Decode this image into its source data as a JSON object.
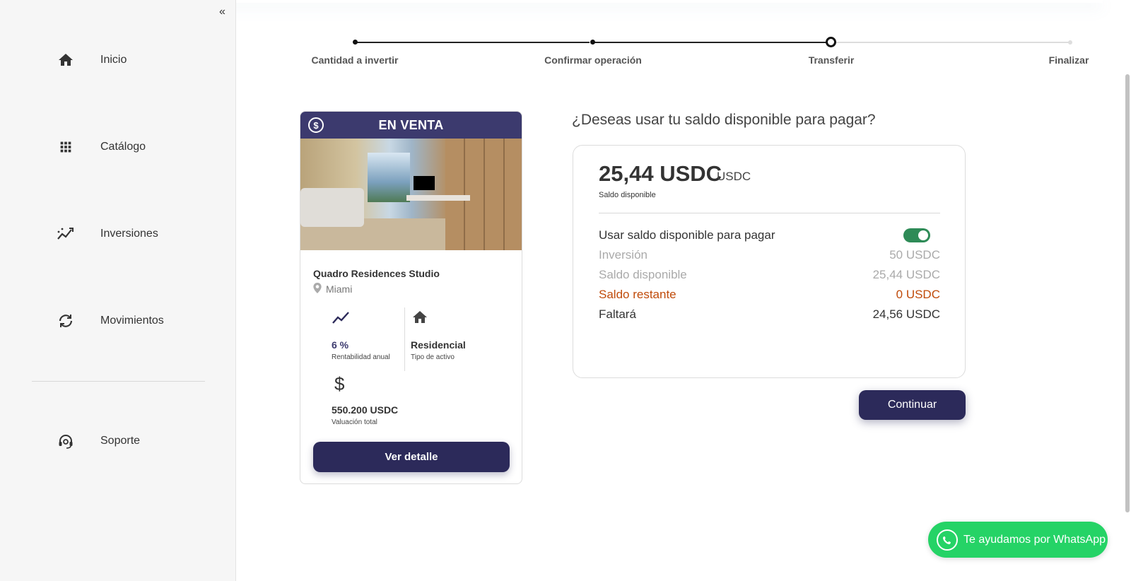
{
  "sidebar": {
    "collapse_icon": "chevron-double-left-icon",
    "items": [
      {
        "label": "Inicio",
        "icon": "home-icon"
      },
      {
        "label": "Catálogo",
        "icon": "grid-icon"
      },
      {
        "label": "Inversiones",
        "icon": "trending-icon"
      },
      {
        "label": "Movimientos",
        "icon": "sync-icon"
      },
      {
        "label": "Soporte",
        "icon": "headset-icon"
      }
    ]
  },
  "stepper": {
    "steps": [
      {
        "label": "Cantidad a invertir",
        "state": "done"
      },
      {
        "label": "Confirmar operación",
        "state": "done"
      },
      {
        "label": "Transferir",
        "state": "current"
      },
      {
        "label": "Finalizar",
        "state": "pending"
      }
    ]
  },
  "property": {
    "badge": "EN VENTA",
    "name": "Quadro Residences Studio",
    "location": "Miami",
    "stats": {
      "rentabilidad_value": "6 %",
      "rentabilidad_label": "Rentabilidad anual",
      "tipo_value": "Residencial",
      "tipo_label": "Tipo de activo",
      "valuacion_value": "550.200 USDC",
      "valuacion_label": "Valuación total"
    },
    "detail_button": "Ver detalle"
  },
  "payment": {
    "question": "¿Deseas usar tu saldo disponible para pagar?",
    "balance_amount": "25,44 USDC",
    "balance_unit": "USDC",
    "balance_label": "Saldo disponible",
    "toggle_label": "Usar saldo disponible para pagar",
    "toggle_on": true,
    "rows": [
      {
        "label": "Inversión",
        "value": "50 USDC"
      },
      {
        "label": "Saldo disponible",
        "value": "25,44 USDC"
      },
      {
        "label": "Saldo restante",
        "value": "0 USDC"
      },
      {
        "label": "Faltará",
        "value": "24,56 USDC"
      }
    ],
    "continue_button": "Continuar"
  },
  "whatsapp": {
    "label": "Te ayudamos por WhatsApp"
  },
  "colors": {
    "primary": "#2c2a5a",
    "header": "#3c3a6e",
    "toggle": "#2e8b57",
    "warning": "#c04b0a",
    "whatsapp": "#25d366"
  }
}
